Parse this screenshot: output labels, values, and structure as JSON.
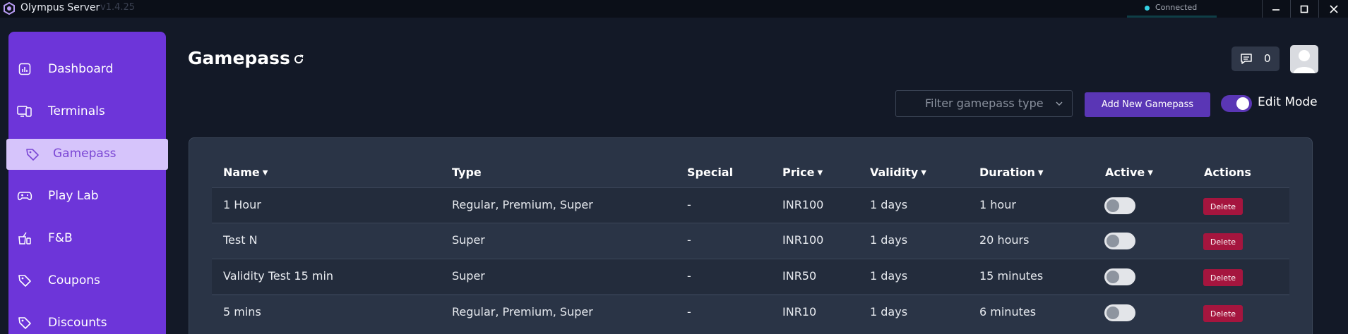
{
  "app": {
    "title": "Olympus Server",
    "version": "v1.4.25"
  },
  "status": {
    "label": "Connected",
    "color": "#34d1e3"
  },
  "window_controls": {
    "minimize": "minimize-icon",
    "maximize": "maximize-icon",
    "close": "close-icon"
  },
  "sidebar": {
    "items": [
      {
        "label": "Dashboard",
        "icon": "dashboard-icon"
      },
      {
        "label": "Terminals",
        "icon": "terminals-icon"
      },
      {
        "label": "Gamepass",
        "icon": "tag-icon",
        "active": true
      },
      {
        "label": "Play Lab",
        "icon": "gamepad-icon"
      },
      {
        "label": "F&B",
        "icon": "food-icon"
      },
      {
        "label": "Coupons",
        "icon": "tag-icon"
      },
      {
        "label": "Discounts",
        "icon": "tag-icon"
      }
    ]
  },
  "header": {
    "title": "Gamepass",
    "messages_count": "0",
    "filter_placeholder": "Filter gamepass type",
    "add_button": "Add New Gamepass",
    "edit_mode_label": "Edit Mode",
    "edit_mode_on": true
  },
  "table": {
    "columns": [
      {
        "label": "Name",
        "sortable": true
      },
      {
        "label": "Type",
        "sortable": false
      },
      {
        "label": "Special",
        "sortable": false
      },
      {
        "label": "Price",
        "sortable": true
      },
      {
        "label": "Validity",
        "sortable": true
      },
      {
        "label": "Duration",
        "sortable": true
      },
      {
        "label": "Active",
        "sortable": true
      },
      {
        "label": "Actions",
        "sortable": false
      }
    ],
    "rows": [
      {
        "name": "1 Hour",
        "type": "Regular, Premium, Super",
        "special": "-",
        "price": "INR100",
        "validity": "1 days",
        "duration": "1 hour",
        "active": false,
        "action": "Delete"
      },
      {
        "name": "Test N",
        "type": "Super",
        "special": "-",
        "price": "INR100",
        "validity": "1 days",
        "duration": "20 hours",
        "active": false,
        "action": "Delete"
      },
      {
        "name": "Validity Test 15 min",
        "type": "Super",
        "special": "-",
        "price": "INR50",
        "validity": "1 days",
        "duration": "15 minutes",
        "active": false,
        "action": "Delete"
      },
      {
        "name": "5 mins",
        "type": "Regular, Premium, Super",
        "special": "-",
        "price": "INR10",
        "validity": "1 days",
        "duration": "6 minutes",
        "active": false,
        "action": "Delete"
      }
    ]
  },
  "colors": {
    "accent": "#6d35d9",
    "button": "#5a36b5",
    "danger": "#a5153e",
    "background": "#131927",
    "card": "#2a3446"
  }
}
